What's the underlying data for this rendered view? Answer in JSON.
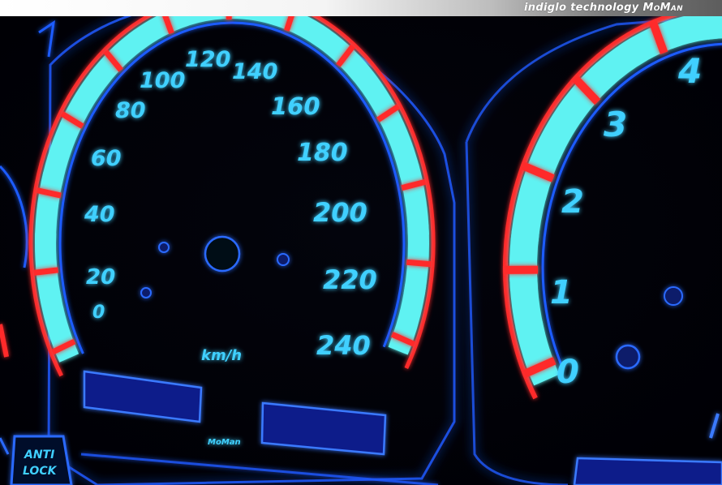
{
  "banner": {
    "text": "indiglo technology",
    "brand": "MoMan"
  },
  "speedometer": {
    "unit": "km/h",
    "numerals": [
      "0",
      "20",
      "40",
      "60",
      "80",
      "100",
      "120",
      "140",
      "160",
      "180",
      "200",
      "220",
      "240"
    ],
    "maker_mark": "MoMan"
  },
  "tachometer": {
    "numerals": [
      "0",
      "1",
      "2",
      "3",
      "4"
    ]
  },
  "warning_light": {
    "line1": "ANTI",
    "line2": "LOCK"
  },
  "colors": {
    "glow_blue": "#1e5bff",
    "cyan": "#5ff2f2",
    "red": "#ff2a2a",
    "numeral": "#3fd0ff"
  }
}
